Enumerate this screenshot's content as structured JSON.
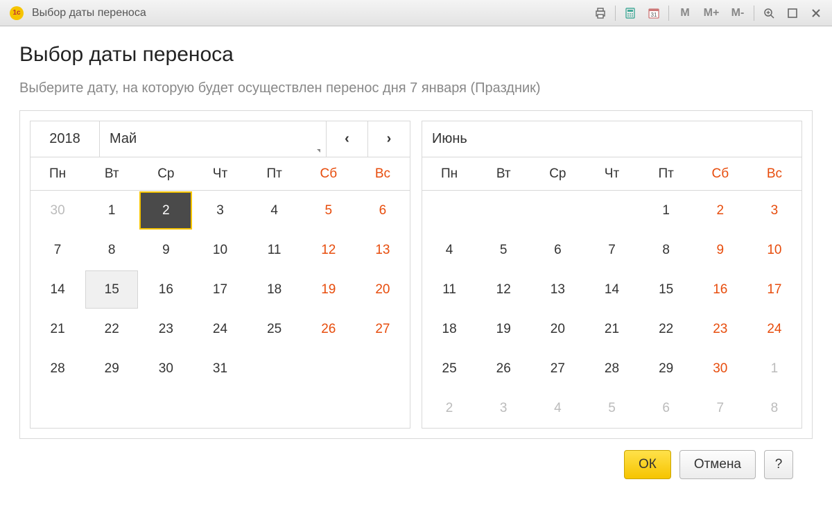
{
  "titlebar": {
    "title": "Выбор даты переноса",
    "memory": {
      "m": "M",
      "mplus": "M+",
      "mminus": "M-"
    }
  },
  "page": {
    "heading": "Выбор даты переноса",
    "instruction": "Выберите дату, на которую будет осуществлен перенос дня 7 января (Праздник)"
  },
  "dow": [
    "Пн",
    "Вт",
    "Ср",
    "Чт",
    "Пт",
    "Сб",
    "Вс"
  ],
  "calendar1": {
    "year": "2018",
    "month": "Май",
    "prev": "‹",
    "next": "›",
    "days": [
      {
        "n": "30",
        "cls": "out"
      },
      {
        "n": "1"
      },
      {
        "n": "2",
        "cls": "selected"
      },
      {
        "n": "3"
      },
      {
        "n": "4"
      },
      {
        "n": "5",
        "cls": "weekend"
      },
      {
        "n": "6",
        "cls": "weekend"
      },
      {
        "n": "7"
      },
      {
        "n": "8"
      },
      {
        "n": "9"
      },
      {
        "n": "10"
      },
      {
        "n": "11"
      },
      {
        "n": "12",
        "cls": "weekend"
      },
      {
        "n": "13",
        "cls": "weekend"
      },
      {
        "n": "14"
      },
      {
        "n": "15",
        "cls": "highlighted"
      },
      {
        "n": "16"
      },
      {
        "n": "17"
      },
      {
        "n": "18"
      },
      {
        "n": "19",
        "cls": "weekend"
      },
      {
        "n": "20",
        "cls": "weekend"
      },
      {
        "n": "21"
      },
      {
        "n": "22"
      },
      {
        "n": "23"
      },
      {
        "n": "24"
      },
      {
        "n": "25"
      },
      {
        "n": "26",
        "cls": "weekend"
      },
      {
        "n": "27",
        "cls": "weekend"
      },
      {
        "n": "28"
      },
      {
        "n": "29"
      },
      {
        "n": "30"
      },
      {
        "n": "31"
      },
      {
        "n": "",
        "cls": "empty"
      },
      {
        "n": "",
        "cls": "empty"
      },
      {
        "n": "",
        "cls": "empty"
      },
      {
        "n": "",
        "cls": "empty"
      },
      {
        "n": "",
        "cls": "empty"
      },
      {
        "n": "",
        "cls": "empty"
      },
      {
        "n": "",
        "cls": "empty"
      },
      {
        "n": "",
        "cls": "empty"
      },
      {
        "n": "",
        "cls": "empty"
      },
      {
        "n": "",
        "cls": "empty"
      }
    ]
  },
  "calendar2": {
    "month": "Июнь",
    "days": [
      {
        "n": "",
        "cls": "empty"
      },
      {
        "n": "",
        "cls": "empty"
      },
      {
        "n": "",
        "cls": "empty"
      },
      {
        "n": "",
        "cls": "empty"
      },
      {
        "n": "1"
      },
      {
        "n": "2",
        "cls": "weekend"
      },
      {
        "n": "3",
        "cls": "weekend"
      },
      {
        "n": "4"
      },
      {
        "n": "5"
      },
      {
        "n": "6"
      },
      {
        "n": "7"
      },
      {
        "n": "8"
      },
      {
        "n": "9",
        "cls": "weekend"
      },
      {
        "n": "10",
        "cls": "weekend"
      },
      {
        "n": "11"
      },
      {
        "n": "12"
      },
      {
        "n": "13"
      },
      {
        "n": "14"
      },
      {
        "n": "15"
      },
      {
        "n": "16",
        "cls": "weekend"
      },
      {
        "n": "17",
        "cls": "weekend"
      },
      {
        "n": "18"
      },
      {
        "n": "19"
      },
      {
        "n": "20"
      },
      {
        "n": "21"
      },
      {
        "n": "22"
      },
      {
        "n": "23",
        "cls": "weekend"
      },
      {
        "n": "24",
        "cls": "weekend"
      },
      {
        "n": "25"
      },
      {
        "n": "26"
      },
      {
        "n": "27"
      },
      {
        "n": "28"
      },
      {
        "n": "29"
      },
      {
        "n": "30",
        "cls": "weekend"
      },
      {
        "n": "1",
        "cls": "out"
      },
      {
        "n": "2",
        "cls": "out"
      },
      {
        "n": "3",
        "cls": "out"
      },
      {
        "n": "4",
        "cls": "out"
      },
      {
        "n": "5",
        "cls": "out"
      },
      {
        "n": "6",
        "cls": "out"
      },
      {
        "n": "7",
        "cls": "out"
      },
      {
        "n": "8",
        "cls": "out"
      }
    ]
  },
  "footer": {
    "ok": "ОК",
    "cancel": "Отмена",
    "help": "?"
  }
}
